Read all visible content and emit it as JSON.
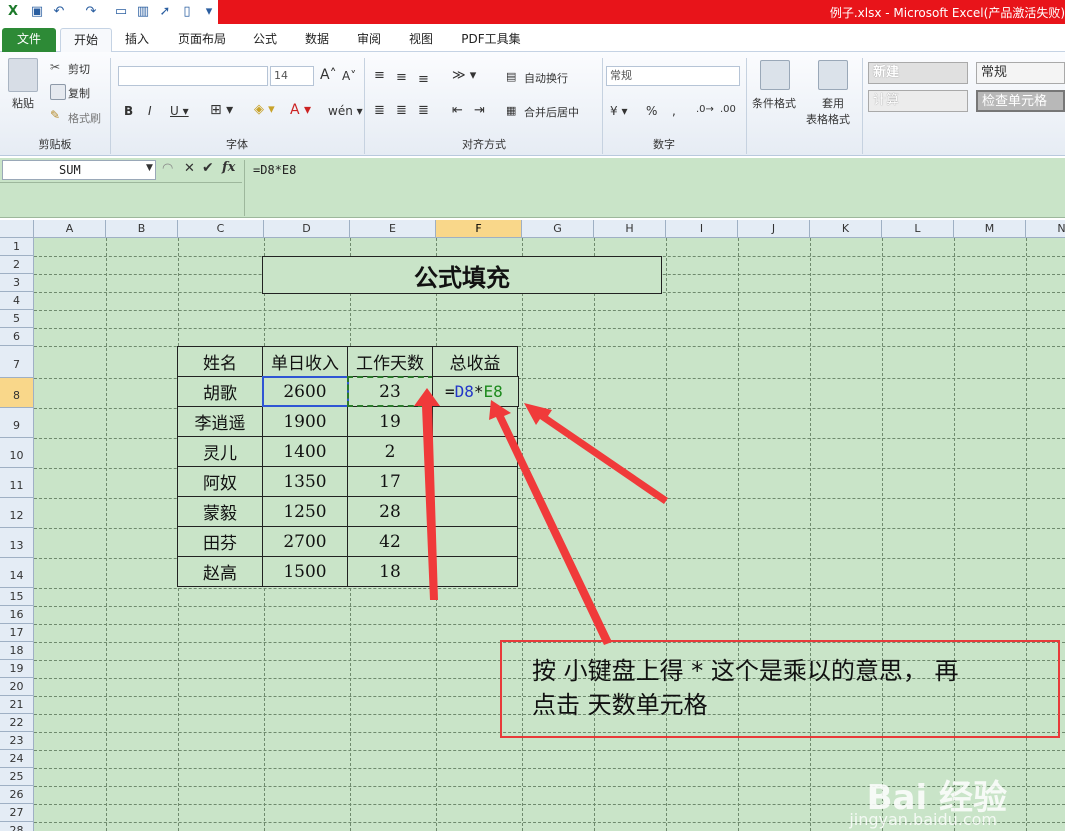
{
  "window": {
    "title": "例子.xlsx - Microsoft Excel(产品激活失败)"
  },
  "tabs": {
    "file": "文件",
    "home": "开始",
    "insert": "插入",
    "layout": "页面布局",
    "formulas": "公式",
    "data": "数据",
    "review": "审阅",
    "view": "视图",
    "pdf": "PDF工具集"
  },
  "ribbon": {
    "paste": "粘贴",
    "cut": "剪切",
    "copy": "复制",
    "format_painter": "格式刷",
    "clipboard_group": "剪贴板",
    "font_size": "14",
    "font_group": "字体",
    "wrap_text": "自动换行",
    "merge_center": "合并后居中",
    "align_group": "对齐方式",
    "number_format": "常规",
    "number_group": "数字",
    "cond_format": "条件格式",
    "table_format_1": "套用",
    "table_format_2": "表格格式",
    "style_new": "新建",
    "style_normal": "常规",
    "style_calc": "计算",
    "style_check": "检查单元格"
  },
  "formula_bar": {
    "name_box": "SUM",
    "formula": "=D8*E8"
  },
  "sheet": {
    "columns": [
      "A",
      "B",
      "C",
      "D",
      "E",
      "F",
      "G",
      "H",
      "I",
      "J",
      "K",
      "L",
      "M",
      "N"
    ],
    "rows": [
      "1",
      "2",
      "3",
      "4",
      "5",
      "6",
      "7",
      "8",
      "9",
      "10",
      "11",
      "12",
      "13",
      "14",
      "15",
      "16",
      "17",
      "18",
      "19",
      "20",
      "21",
      "22",
      "23",
      "24",
      "25",
      "26",
      "27",
      "28"
    ],
    "title": "公式填充",
    "headers": [
      "姓名",
      "单日收入",
      "工作天数",
      "总收益"
    ],
    "records": [
      [
        "胡歌",
        "2600",
        "23"
      ],
      [
        "李逍遥",
        "1900",
        "19"
      ],
      [
        "灵儿",
        "1400",
        "2"
      ],
      [
        "阿奴",
        "1350",
        "17"
      ],
      [
        "蒙毅",
        "1250",
        "28"
      ],
      [
        "田芬",
        "2700",
        "42"
      ],
      [
        "赵高",
        "1500",
        "18"
      ]
    ],
    "edit_formula": {
      "eq": "=",
      "ref1": "D8",
      "op": "*",
      "ref2": "E8"
    }
  },
  "annotation": {
    "line1": "按 小键盘上得 *  这个是乘以的意思， 再",
    "line2": "点击 天数单元格"
  },
  "watermark": {
    "logo": "Bai  经验",
    "url": "jingyan.baidu.com"
  },
  "colors": {
    "accent": "#2d8a36",
    "grid_bg": "#c9e4c8",
    "highlight": "#e83a3a",
    "ref_blue": "#2236c8",
    "ref_green": "#1c8a1c"
  }
}
